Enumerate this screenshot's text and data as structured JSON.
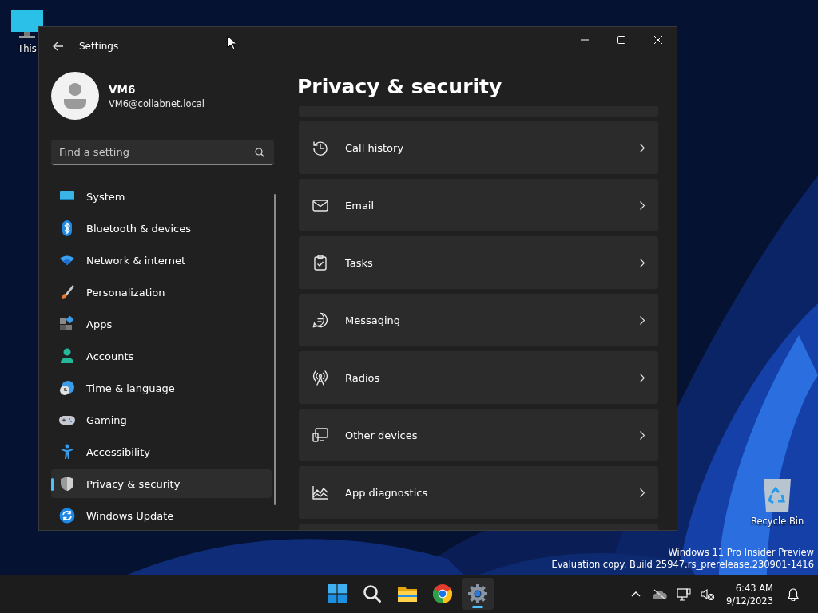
{
  "desktop": {
    "icons": [
      {
        "label": "This"
      },
      {
        "label": "Recycle Bin"
      }
    ],
    "watermark": [
      "Windows 11 Pro Insider Preview",
      "Evaluation copy. Build 25947.rs_prerelease.230901-1416"
    ]
  },
  "window": {
    "title": "Settings",
    "account": {
      "name": "VM6",
      "email": "VM6@collabnet.local"
    },
    "search": {
      "placeholder": "Find a setting"
    },
    "nav": [
      {
        "label": "System",
        "selected": false
      },
      {
        "label": "Bluetooth & devices",
        "selected": false
      },
      {
        "label": "Network & internet",
        "selected": false
      },
      {
        "label": "Personalization",
        "selected": false
      },
      {
        "label": "Apps",
        "selected": false
      },
      {
        "label": "Accounts",
        "selected": false
      },
      {
        "label": "Time & language",
        "selected": false
      },
      {
        "label": "Gaming",
        "selected": false
      },
      {
        "label": "Accessibility",
        "selected": false
      },
      {
        "label": "Privacy & security",
        "selected": true
      },
      {
        "label": "Windows Update",
        "selected": false
      }
    ],
    "heading": "Privacy & security",
    "items": [
      {
        "label": "Call history"
      },
      {
        "label": "Email"
      },
      {
        "label": "Tasks"
      },
      {
        "label": "Messaging"
      },
      {
        "label": "Radios"
      },
      {
        "label": "Other devices"
      },
      {
        "label": "App diagnostics"
      }
    ]
  },
  "taskbar": {
    "apps": [
      {
        "kind": "start",
        "selected": false
      },
      {
        "kind": "search",
        "selected": false
      },
      {
        "kind": "explorer",
        "selected": false
      },
      {
        "kind": "browser",
        "selected": false
      },
      {
        "kind": "settings",
        "selected": true
      }
    ],
    "time": "6:43 AM",
    "date": "9/12/2023"
  }
}
